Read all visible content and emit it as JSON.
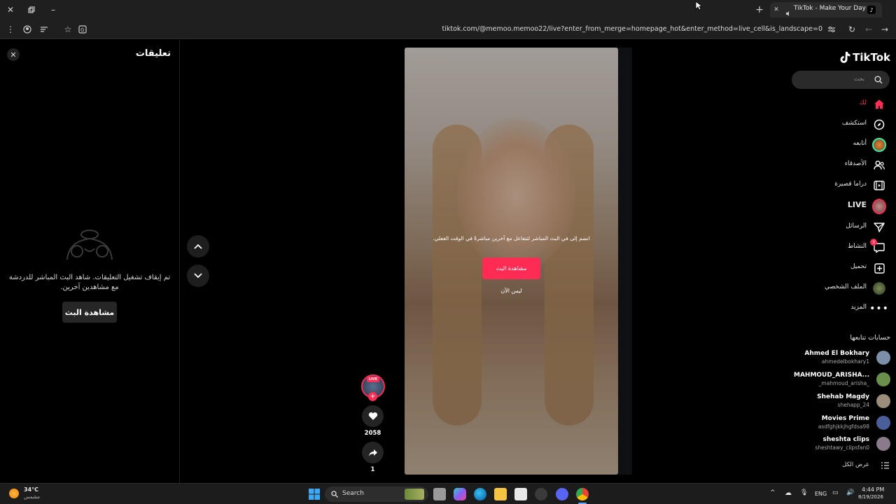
{
  "browser": {
    "tab_title": "TikTok - Make Your Day",
    "url": "tiktok.com/@memoo.memoo22/live?enter_from_merge=homepage_hot&enter_method=live_cell&is_landscape=0"
  },
  "comments_panel": {
    "title": "تعليقات",
    "message": "تم إيقاف تشغيل التعليقات. شاهد البث المباشر للدردشة مع مشاهدين آخرين.",
    "watch_button": "مشاهدة البث"
  },
  "video": {
    "prompt": "انضم إلى في البث المباشر لتتفاعل مع آخرين مباشرةً في الوقت الفعلي.",
    "watch_button": "مشاهدة البث",
    "not_now": "ليس الآن"
  },
  "actions": {
    "live_badge": "LIVE",
    "likes": "2058",
    "shares": "1"
  },
  "sidebar": {
    "logo": "TikTok",
    "search_placeholder": "بحث",
    "nav": [
      {
        "label": "لك",
        "icon": "home-icon"
      },
      {
        "label": "استكشف",
        "icon": "compass-icon"
      },
      {
        "label": "أتابعه",
        "icon": "following-avatar-icon"
      },
      {
        "label": "الأصدقاء",
        "icon": "friends-icon"
      },
      {
        "label": "دراما قصيرة",
        "icon": "drama-icon"
      },
      {
        "label": "LIVE",
        "icon": "live-avatar-icon"
      },
      {
        "label": "الرسائل",
        "icon": "send-icon"
      },
      {
        "label": "النشاط",
        "icon": "activity-icon",
        "badge": "3"
      },
      {
        "label": "تحميل",
        "icon": "upload-icon"
      },
      {
        "label": "الملف الشخصي",
        "icon": "profile-avatar-icon"
      },
      {
        "label": "المزيد",
        "icon": "more-icon"
      }
    ],
    "following_title": "حسابات تتابعها",
    "accounts": [
      {
        "name": "Ahmed El Bokhary",
        "handle": "ahmedelbokhary1",
        "color": "#7d8ea8"
      },
      {
        "name": "MAHMOUD_ARISHA...",
        "handle": "_mahmoud_arisha_",
        "color": "#6a8f4a"
      },
      {
        "name": "Shehab Magdy",
        "handle": "shehapp_24",
        "color": "#9a8d7a"
      },
      {
        "name": "Movies Prime",
        "handle": "asdfghjkkjhgfdsa98",
        "color": "#4a5f9a"
      },
      {
        "name": "sheshta clips",
        "handle": "sheshtawy_clipsfan0",
        "color": "#8a7a8a"
      }
    ],
    "see_all": "عرض الكل"
  },
  "taskbar": {
    "weather_temp": "34°C",
    "weather_desc": "مشمس",
    "search_label": "Search",
    "lang": "ENG",
    "time": "4:44 PM",
    "date": "8/19/2026"
  }
}
